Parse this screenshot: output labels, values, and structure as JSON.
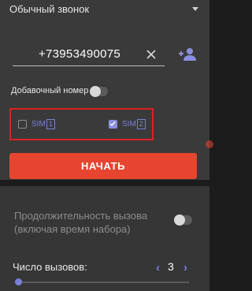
{
  "call_type": {
    "value": "Обычный звонок"
  },
  "phone": {
    "value": "+73953490075"
  },
  "extension": {
    "label": "Добавочный номер",
    "enabled": false
  },
  "sim": [
    {
      "label": "SIM",
      "number": "1",
      "checked": false
    },
    {
      "label": "SIM",
      "number": "2",
      "checked": true
    }
  ],
  "start_button": {
    "label": "НАЧАТЬ"
  },
  "duration": {
    "label": "Продолжительность вызова (включая время набора)",
    "enabled": false
  },
  "calls": {
    "label": "Число вызовов:",
    "value": "3",
    "slider_fraction": 0
  },
  "colors": {
    "accent": "#7a7fd8",
    "start_button": "#e74530",
    "highlight_box": "#e02020"
  },
  "icons": [
    "chevron-down-icon",
    "clear-icon",
    "add-contact-icon",
    "chevron-left-icon",
    "chevron-right-icon"
  ]
}
